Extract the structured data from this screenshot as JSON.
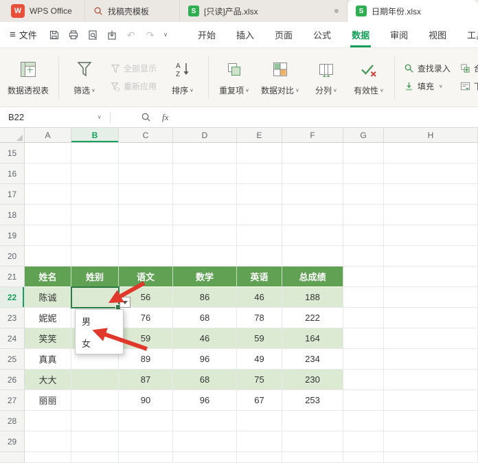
{
  "colors": {
    "accent": "#14a05a",
    "table_header": "#61a154",
    "band": "#dcead3",
    "selection": "#2c7a44",
    "arrow_red": "#e0392c",
    "wps_red": "#e8503a",
    "sheet_green": "#2fae52"
  },
  "window_tabs": [
    {
      "label": "WPS Office"
    },
    {
      "label": "找稿壳模板"
    },
    {
      "label": "[只读]产品.xlsx"
    },
    {
      "label": "日期年份.xlsx"
    }
  ],
  "menu": {
    "file": "文件",
    "items": [
      "开始",
      "插入",
      "页面",
      "公式",
      "数据",
      "审阅",
      "视图",
      "工具"
    ],
    "active_item": "数据"
  },
  "ribbon": {
    "pivot_table": "数据透视表",
    "filter": "筛选",
    "show_all": "全部显示",
    "reapply": "重新应用",
    "sort": "排序",
    "duplicates": "重复项",
    "data_compare": "数据对比",
    "text_to_columns": "分列",
    "validation": "有效性",
    "lookup_entry": "查找录入",
    "fill": "填充",
    "consolidate": "合并计算",
    "dropdown_list": "下拉列表"
  },
  "formula_bar": {
    "name_box": "B22",
    "fx_label": "fx",
    "formula_content": ""
  },
  "grid": {
    "column_letters": [
      "A",
      "B",
      "C",
      "D",
      "E",
      "F",
      "G",
      "H"
    ],
    "row_numbers": [
      15,
      16,
      17,
      18,
      19,
      20,
      21,
      22,
      23,
      24,
      25,
      26,
      27,
      28,
      29
    ],
    "selected_cell": "B22",
    "selected_column": "B",
    "selected_row": 22
  },
  "table": {
    "header_row": 21,
    "columns": [
      "姓名",
      "姓别",
      "语文",
      "数学",
      "英语",
      "总成绩"
    ],
    "rows": [
      {
        "row": 22,
        "cells": [
          "陈诚",
          "",
          "56",
          "86",
          "46",
          "188"
        ]
      },
      {
        "row": 23,
        "cells": [
          "妮妮",
          "",
          "76",
          "68",
          "78",
          "222"
        ]
      },
      {
        "row": 24,
        "cells": [
          "笑笑",
          "",
          "59",
          "46",
          "59",
          "164"
        ]
      },
      {
        "row": 25,
        "cells": [
          "真真",
          "",
          "89",
          "96",
          "49",
          "234"
        ]
      },
      {
        "row": 26,
        "cells": [
          "大大",
          "",
          "87",
          "68",
          "75",
          "230"
        ]
      },
      {
        "row": 27,
        "cells": [
          "丽丽",
          "",
          "90",
          "96",
          "67",
          "253"
        ]
      }
    ]
  },
  "dropdown": {
    "options": [
      "男",
      "女"
    ]
  }
}
